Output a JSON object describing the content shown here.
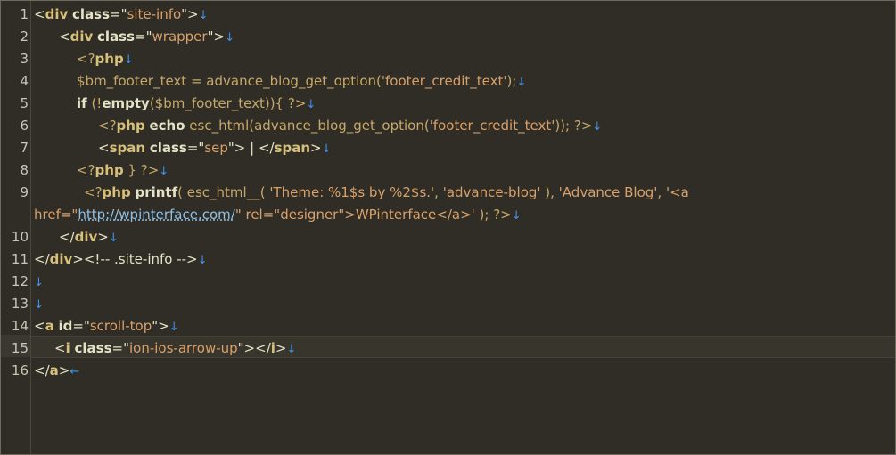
{
  "editor": {
    "line_numbers": [
      "1",
      "2",
      "3",
      "4",
      "5",
      "6",
      "7",
      "8",
      "9",
      "10",
      "11",
      "12",
      "13",
      "14",
      "15",
      "16"
    ],
    "newline_mark": "↓",
    "eof_mark": "←",
    "code": {
      "l1": [
        "<",
        "div",
        " ",
        "class",
        "=\"",
        "site-info",
        "\">"
      ],
      "l2": [
        "<",
        "div",
        " ",
        "class",
        "=\"",
        "wrapper",
        "\">"
      ],
      "l3": [
        "<?",
        "php"
      ],
      "l4": [
        "$bm_footer_text = advance_blog_get_option(",
        "'footer_credit_text'",
        ");"
      ],
      "l5": [
        "if",
        " (!",
        "empty",
        "($bm_footer_text)){ ?>"
      ],
      "l6": [
        "<?",
        "php",
        " ",
        "echo",
        " esc_html(advance_blog_get_option(",
        "'footer_credit_text'",
        ")); ?>"
      ],
      "l7": [
        "<",
        "span",
        " ",
        "class",
        "=\"",
        "sep",
        "\"> | </",
        "span",
        ">"
      ],
      "l8": [
        "<?",
        "php",
        " } ?>"
      ],
      "l9a": [
        "<?",
        "php",
        " ",
        "printf",
        "( esc_html__( ",
        "'Theme: %1$s by %2$s.'",
        ", ",
        "'advance-blog'",
        " ), ",
        "'Advance Blog'",
        ", ",
        "'<a"
      ],
      "l9b": [
        "href=\"",
        "http://wpinterface.com/",
        "\" rel=\"designer\">WPinterface</a>'",
        " ); ?>"
      ],
      "l10": [
        "</",
        "div",
        ">"
      ],
      "l11": [
        "</",
        "div",
        "><!-- .site-info -->"
      ],
      "l14": [
        "<",
        "a",
        " ",
        "id",
        "=\"",
        "scroll-top",
        "\">"
      ],
      "l15": [
        "<",
        "i",
        " ",
        "class",
        "=\"",
        "ion-ios-arrow-up",
        "\"></",
        "i",
        ">"
      ],
      "l16": [
        "</",
        "a",
        ">"
      ]
    }
  }
}
